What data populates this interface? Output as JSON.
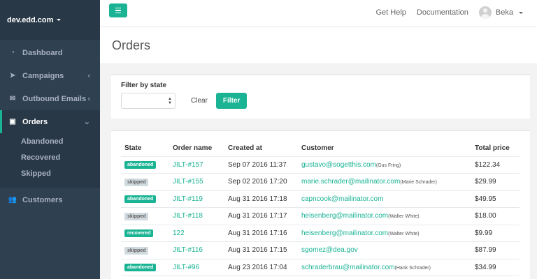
{
  "sidebar": {
    "brand": "dev.edd.com",
    "items": [
      {
        "label": "Dashboard",
        "icon": "tachometer-icon",
        "glyph": "◔",
        "chevron": ""
      },
      {
        "label": "Campaigns",
        "icon": "paper-plane-icon",
        "glyph": "➤",
        "chevron": "‹"
      },
      {
        "label": "Outbound Emails",
        "icon": "envelope-icon",
        "glyph": "✉",
        "chevron": "‹"
      },
      {
        "label": "Orders",
        "icon": "money-icon",
        "glyph": "▣",
        "chevron": "⌄"
      },
      {
        "label": "Customers",
        "icon": "users-icon",
        "glyph": "👥",
        "chevron": ""
      }
    ],
    "orders_subitems": [
      "Abandoned",
      "Recovered",
      "Skipped"
    ]
  },
  "topbar": {
    "help": "Get Help",
    "docs": "Documentation",
    "user": "Beka"
  },
  "page": {
    "title": "Orders"
  },
  "filter": {
    "label": "Filter by state",
    "clear": "Clear",
    "button": "Filter"
  },
  "table": {
    "headers": [
      "State",
      "Order name",
      "Created at",
      "Customer",
      "Total price"
    ],
    "rows": [
      {
        "state": "abandoned",
        "order": "JILT-#157",
        "created": "Sep 07 2016 11:37",
        "email": "gustavo@sogetthis.com",
        "name": "(Gus Fring)",
        "price": "$122.34"
      },
      {
        "state": "skipped",
        "order": "JILT-#155",
        "created": "Sep 02 2016 17:20",
        "email": "marie.schrader@mailinator.com",
        "name": "(Marie Schrader)",
        "price": "$29.99"
      },
      {
        "state": "abandoned",
        "order": "JILT-#119",
        "created": "Aug 31 2016 17:18",
        "email": "capncook@mailinator.com",
        "name": "",
        "price": "$49.95"
      },
      {
        "state": "skipped",
        "order": "JILT-#118",
        "created": "Aug 31 2016 17:17",
        "email": "heisenberg@mailinator.com",
        "name": "(Walter White)",
        "price": "$18.00"
      },
      {
        "state": "recovered",
        "order": "122",
        "created": "Aug 31 2016 17:16",
        "email": "heisenberg@mailinator.com",
        "name": "(Walter White)",
        "price": "$9.99"
      },
      {
        "state": "skipped",
        "order": "JILT-#116",
        "created": "Aug 31 2016 17:15",
        "email": "sgomez@dea.gov",
        "name": "",
        "price": "$87.99"
      },
      {
        "state": "abandoned",
        "order": "JILT-#96",
        "created": "Aug 23 2016 17:04",
        "email": "schraderbrau@mailinator.com",
        "name": "(Hank Schrader)",
        "price": "$34.99"
      }
    ]
  },
  "colors": {
    "accent": "#1ab394",
    "sidebar": "#2f4050"
  }
}
